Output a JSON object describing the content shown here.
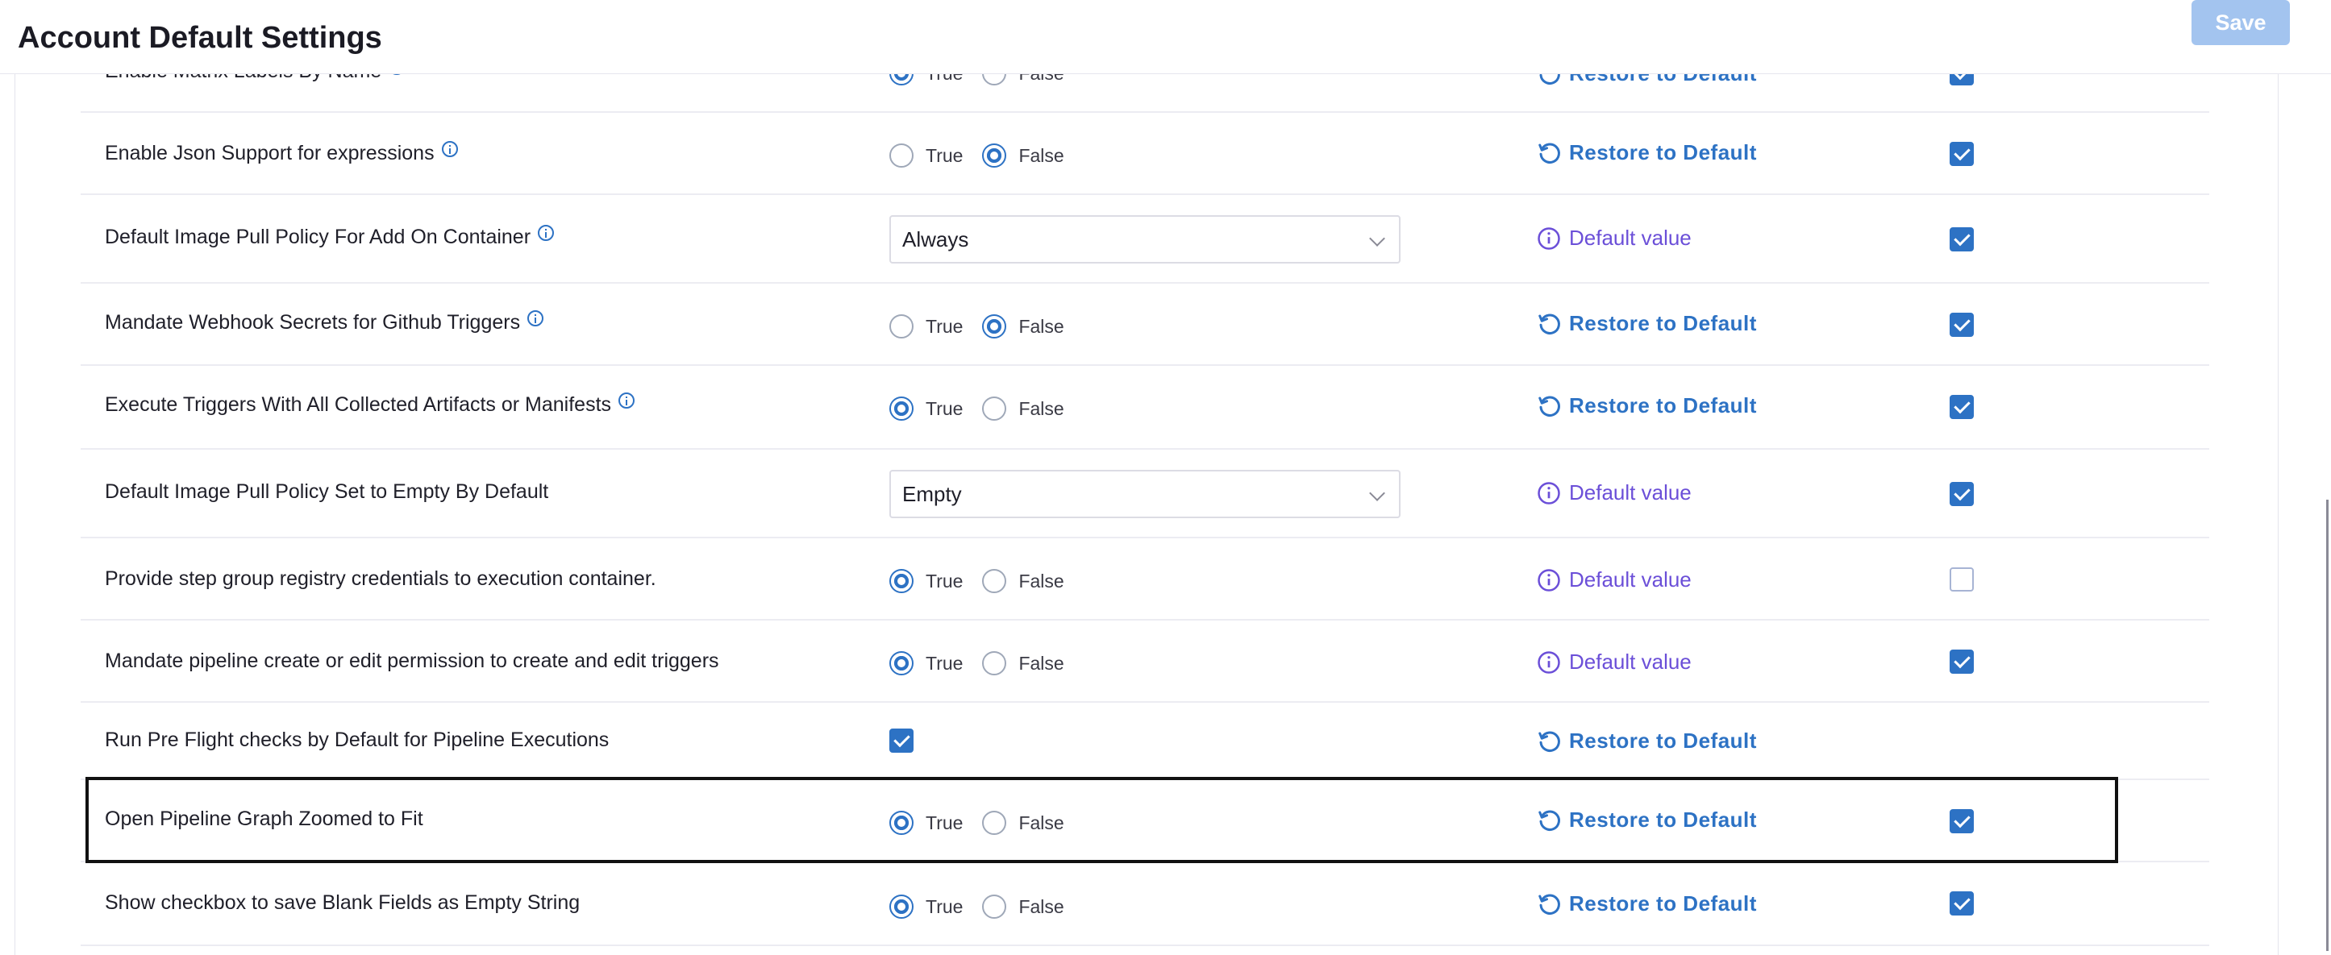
{
  "header": {
    "title": "Account Default Settings",
    "save_label": "Save"
  },
  "rows": [
    {
      "label": "Enable Matrix Labels By Name",
      "type": "radio",
      "value": "True",
      "action": "Restore to Default",
      "action_kind": "restore",
      "override": true
    },
    {
      "label": "Enable Json Support for expressions",
      "type": "radio",
      "value": "False",
      "action": "Restore to Default",
      "action_kind": "restore",
      "override": true
    },
    {
      "label": "Default Image Pull Policy For Add On Container",
      "type": "select",
      "value": "Always",
      "action": "Default value",
      "action_kind": "default",
      "override": true
    },
    {
      "label": "Mandate Webhook Secrets for Github Triggers",
      "type": "radio",
      "value": "False",
      "action": "Restore to Default",
      "action_kind": "restore",
      "override": true
    },
    {
      "label": "Execute Triggers With All Collected Artifacts or Manifests",
      "type": "radio",
      "value": "True",
      "action": "Restore to Default",
      "action_kind": "restore",
      "override": true
    },
    {
      "label": "Default Image Pull Policy Set to Empty By Default",
      "type": "select",
      "value": "Empty",
      "action": "Default value",
      "action_kind": "default",
      "override": true
    },
    {
      "label": "Provide step group registry credentials to execution container.",
      "type": "radio",
      "value": "True",
      "action": "Default value",
      "action_kind": "default",
      "override": false
    },
    {
      "label": "Mandate pipeline create or edit permission to create and edit triggers",
      "type": "radio",
      "value": "True",
      "action": "Default value",
      "action_kind": "default",
      "override": true
    },
    {
      "label": "Run Pre Flight checks by Default for Pipeline Executions",
      "type": "checkbox",
      "value": true,
      "action": "Restore to Default",
      "action_kind": "restore",
      "override": null
    },
    {
      "label": "Open Pipeline Graph Zoomed to Fit",
      "type": "radio",
      "value": "True",
      "action": "Restore to Default",
      "action_kind": "restore",
      "override": true,
      "highlighted": true
    },
    {
      "label": "Show checkbox to save Blank Fields as Empty String",
      "type": "radio",
      "value": "True",
      "action": "Restore to Default",
      "action_kind": "restore",
      "override": true
    }
  ],
  "radio_options": {
    "true_label": "True",
    "false_label": "False"
  },
  "colors": {
    "accent": "#2d72c4",
    "default_value": "#6b4fd8",
    "save_disabled": "#a3c4ef",
    "highlight_border": "#111111"
  }
}
